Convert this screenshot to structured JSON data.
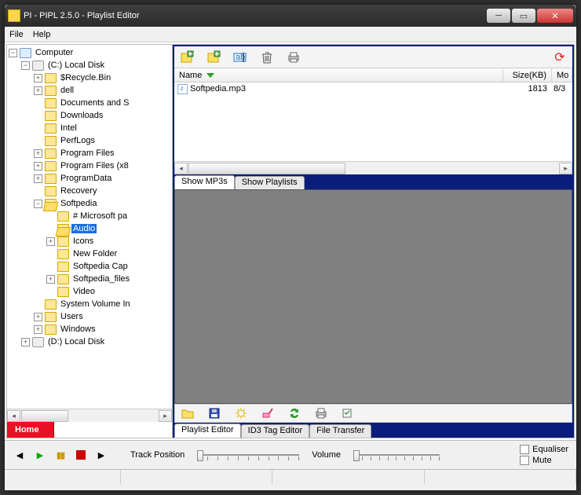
{
  "window": {
    "title": "PI - PIPL 2.5.0 - Playlist Editor"
  },
  "menu": {
    "file": "File",
    "help": "Help"
  },
  "tree": {
    "root": "Computer",
    "cdrive": "(C:) Local Disk",
    "items": [
      "$Recycle.Bin",
      "dell",
      "Documents and S",
      "Downloads",
      "Intel",
      "PerfLogs",
      "Program Files",
      "Program Files (x8",
      "ProgramData",
      "Recovery"
    ],
    "softpedia": "Softpedia",
    "sub": [
      "# Microsoft pa",
      "Audio",
      "Icons",
      "New Folder",
      "Softpedia Cap",
      "Softpedia_files",
      "Video"
    ],
    "tail": [
      "System Volume In",
      "Users",
      "Windows"
    ],
    "ddrive": "(D:) Local Disk"
  },
  "home": "Home",
  "columns": {
    "name": "Name",
    "size": "Size(KB)",
    "mod": "Mo"
  },
  "files": [
    {
      "name": "Softpedia.mp3",
      "size": "1813",
      "mod": "8/3"
    }
  ],
  "filetabs": {
    "mp3": "Show MP3s",
    "playlists": "Show Playlists"
  },
  "btabs": {
    "playlist": "Playlist Editor",
    "id3": "ID3 Tag Editor",
    "transfer": "File Transfer"
  },
  "playback": {
    "trackpos": "Track Position",
    "volume": "Volume",
    "equaliser": "Equaliser",
    "mute": "Mute"
  }
}
